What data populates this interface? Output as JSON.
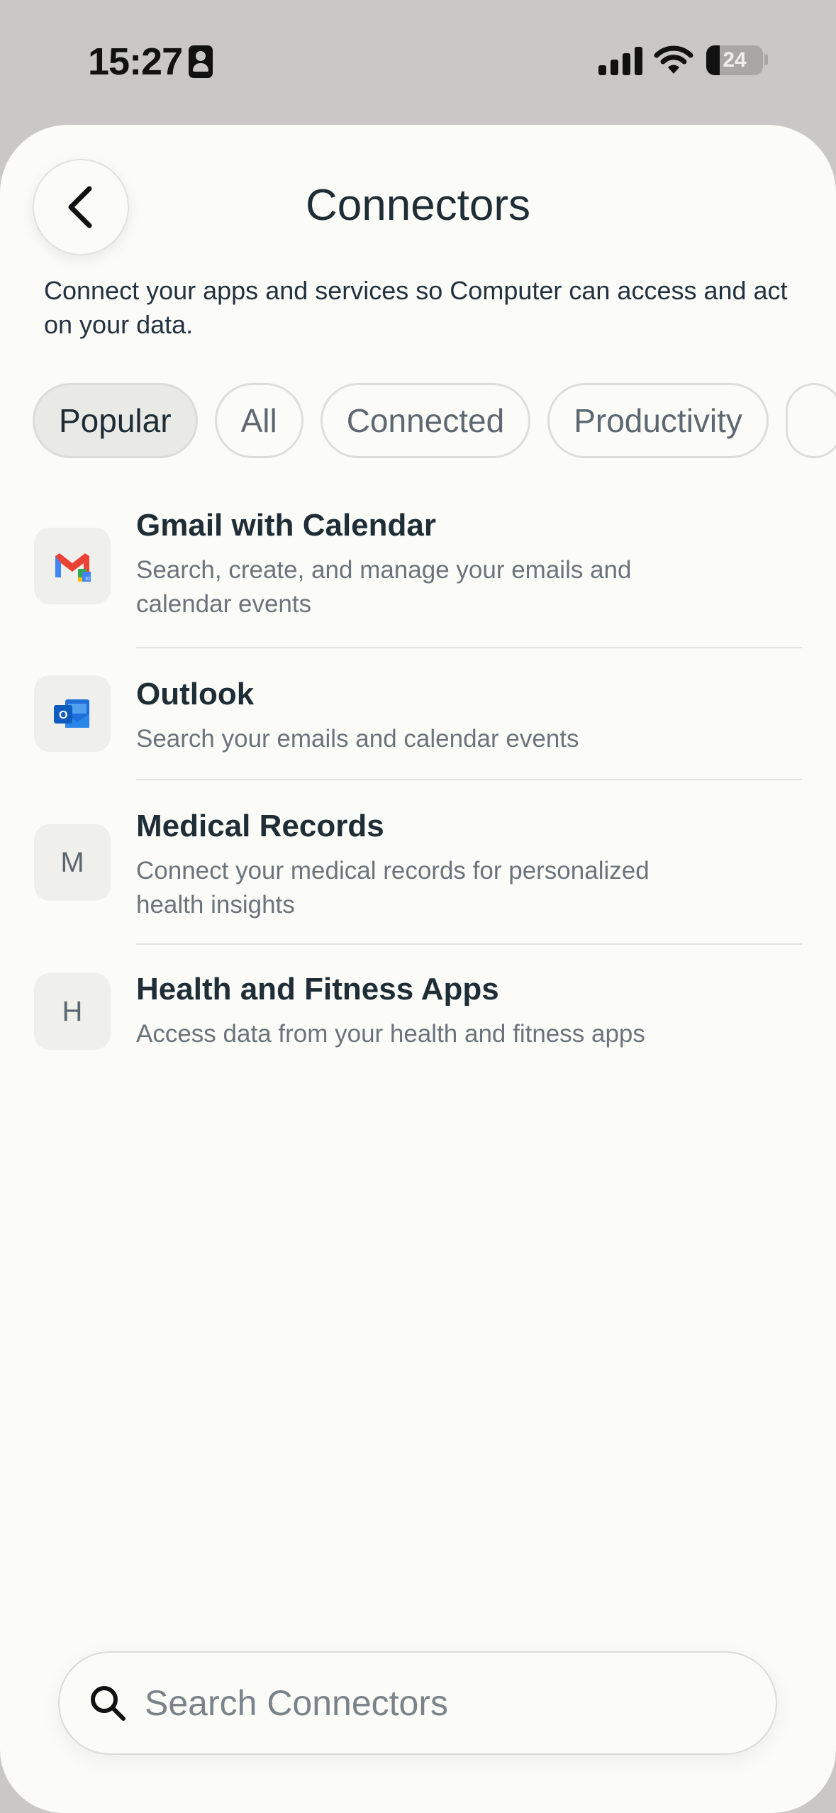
{
  "status": {
    "time": "15:27",
    "battery": "24"
  },
  "header": {
    "title": "Connectors",
    "subtitle": "Connect your apps and services so Computer can access and act on your data."
  },
  "filters": [
    "Popular",
    "All",
    "Connected",
    "Productivity"
  ],
  "connectors": [
    {
      "title": "Gmail with Calendar",
      "desc": "Search, create, and manage your emails and calendar events",
      "icon": "gmail-calendar-icon"
    },
    {
      "title": "Outlook",
      "desc": "Search your emails and calendar events",
      "icon": "outlook-icon"
    },
    {
      "title": "Medical Records",
      "desc": "Connect your medical records for personalized health insights",
      "icon_letter": "M"
    },
    {
      "title": "Health and Fitness Apps",
      "desc": "Access data from your health and fitness apps",
      "icon_letter": "H"
    }
  ],
  "search": {
    "placeholder": "Search Connectors"
  },
  "colors": {
    "sheet": "#fbfbf7",
    "text": "#1e2d36",
    "muted": "#6b747c"
  }
}
